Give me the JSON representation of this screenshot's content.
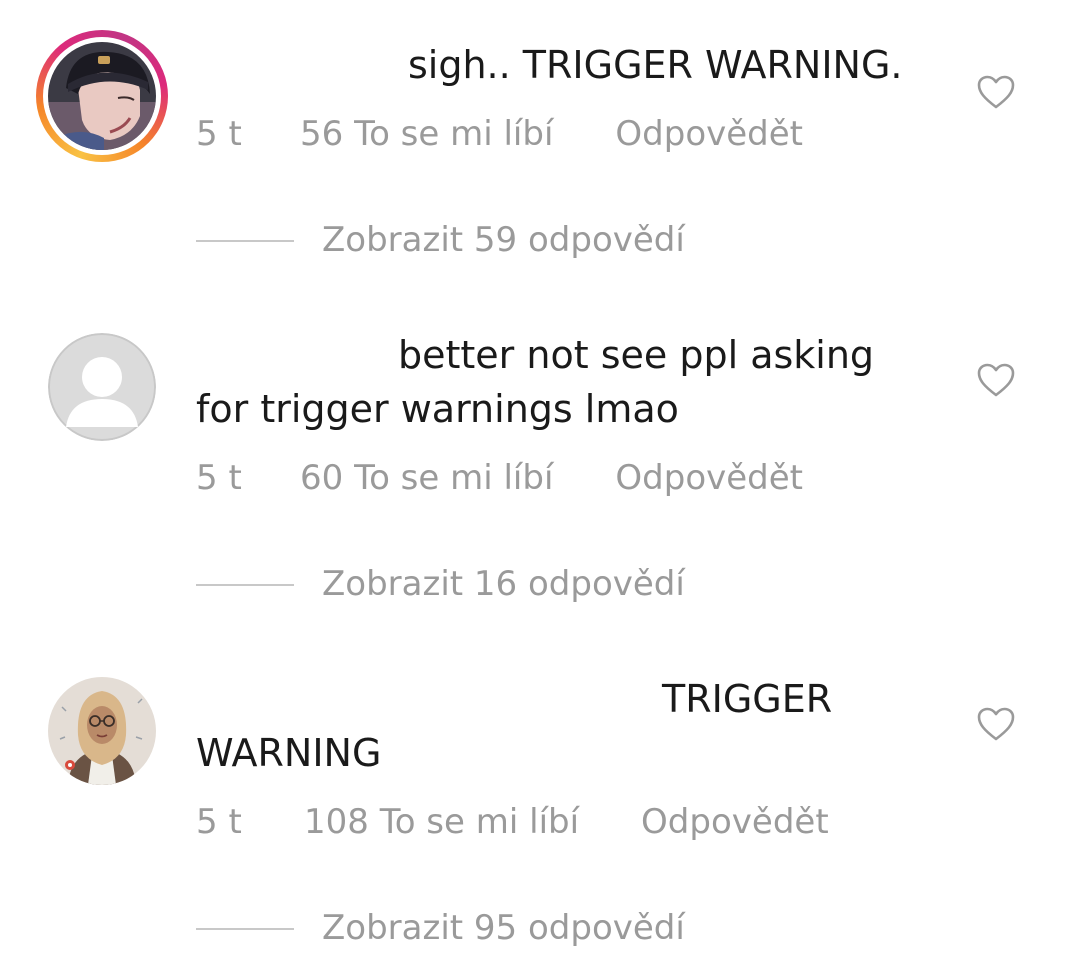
{
  "comments": [
    {
      "text": "sigh.. TRIGGER WARNING.",
      "time": "5 t",
      "likes": "56 To se mi líbí",
      "reply": "Odpovědět",
      "view_replies": "Zobrazit 59 odpovědí",
      "avatar_icon": "anime-portrait-avatar",
      "has_story_ring": true
    },
    {
      "text_line1": "better not see ppl asking",
      "text_line2": "for trigger warnings lmao",
      "time": "5 t",
      "likes": "60 To se mi líbí",
      "reply": "Odpovědět",
      "view_replies": "Zobrazit 16 odpovědí",
      "avatar_icon": "default-user-avatar"
    },
    {
      "text_line1": "TRIGGER",
      "text_line2": "WARNING",
      "time": "5 t",
      "likes": "108 To se mi líbí",
      "reply": "Odpovědět",
      "view_replies": "Zobrazit 95 odpovědí",
      "avatar_icon": "illustrated-hijab-avatar"
    }
  ],
  "colors": {
    "text": "#1a1a1a",
    "meta": "#9a9a9a",
    "divider": "#c8c8c8",
    "story_ring": [
      "#f9c244",
      "#f58529",
      "#dd2a7b",
      "#c13584"
    ]
  },
  "icons": {
    "like": "heart-outline-icon"
  }
}
